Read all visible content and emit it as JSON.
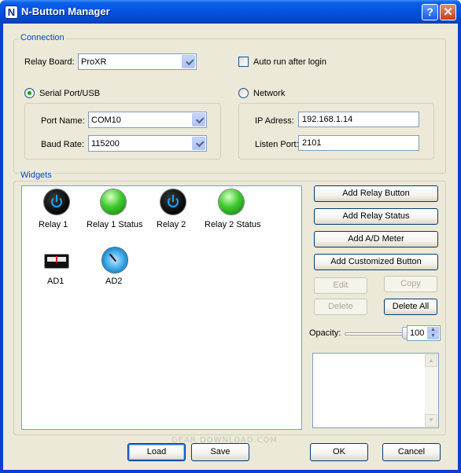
{
  "window": {
    "title": "N-Button Manager",
    "icon_letter": "N",
    "help_glyph": "?",
    "close_glyph": "✕"
  },
  "connection": {
    "group_title": "Connection",
    "relay_board_label": "Relay Board:",
    "relay_board_value": "ProXR",
    "auto_run_label": "Auto run after login",
    "auto_run_checked": false,
    "serial_label": "Serial Port/USB",
    "serial_selected": true,
    "network_label": "Network",
    "network_selected": false,
    "port_name_label": "Port Name:",
    "port_name_value": "COM10",
    "baud_rate_label": "Baud Rate:",
    "baud_rate_value": "115200",
    "ip_label": "IP Adress:",
    "ip_value": "192.168.1.14",
    "listen_port_label": "Listen Port:",
    "listen_port_value": "2101"
  },
  "widgets": {
    "group_title": "Widgets",
    "items": [
      {
        "label": "Relay 1",
        "icon": "power-icon"
      },
      {
        "label": "Relay 1 Status",
        "icon": "green-led-icon"
      },
      {
        "label": "Relay 2",
        "icon": "power-icon"
      },
      {
        "label": "Relay 2 Status",
        "icon": "green-led-icon"
      },
      {
        "label": "AD1",
        "icon": "meter-icon"
      },
      {
        "label": "AD2",
        "icon": "gauge-icon"
      }
    ],
    "buttons": {
      "add_relay_button": "Add Relay Button",
      "add_relay_status": "Add Relay Status",
      "add_ad_meter": "Add A/D Meter",
      "add_customized_button": "Add Customized Button",
      "edit": "Edit",
      "copy": "Copy",
      "delete": "Delete",
      "delete_all": "Delete All"
    },
    "opacity_label": "Opacity:",
    "opacity_value": "100",
    "opacity_level": 1.0
  },
  "footer": {
    "load": "Load",
    "save": "Save",
    "ok": "OK",
    "cancel": "Cancel",
    "watermark": "GEAR DOWNLOAD.COM"
  },
  "colors": {
    "titlebar": "#0552e0",
    "dialog_bg": "#ece9d8",
    "group_title": "#0046d5",
    "led_green": "#3ecb2e",
    "power_blue": "#17a6ff"
  }
}
